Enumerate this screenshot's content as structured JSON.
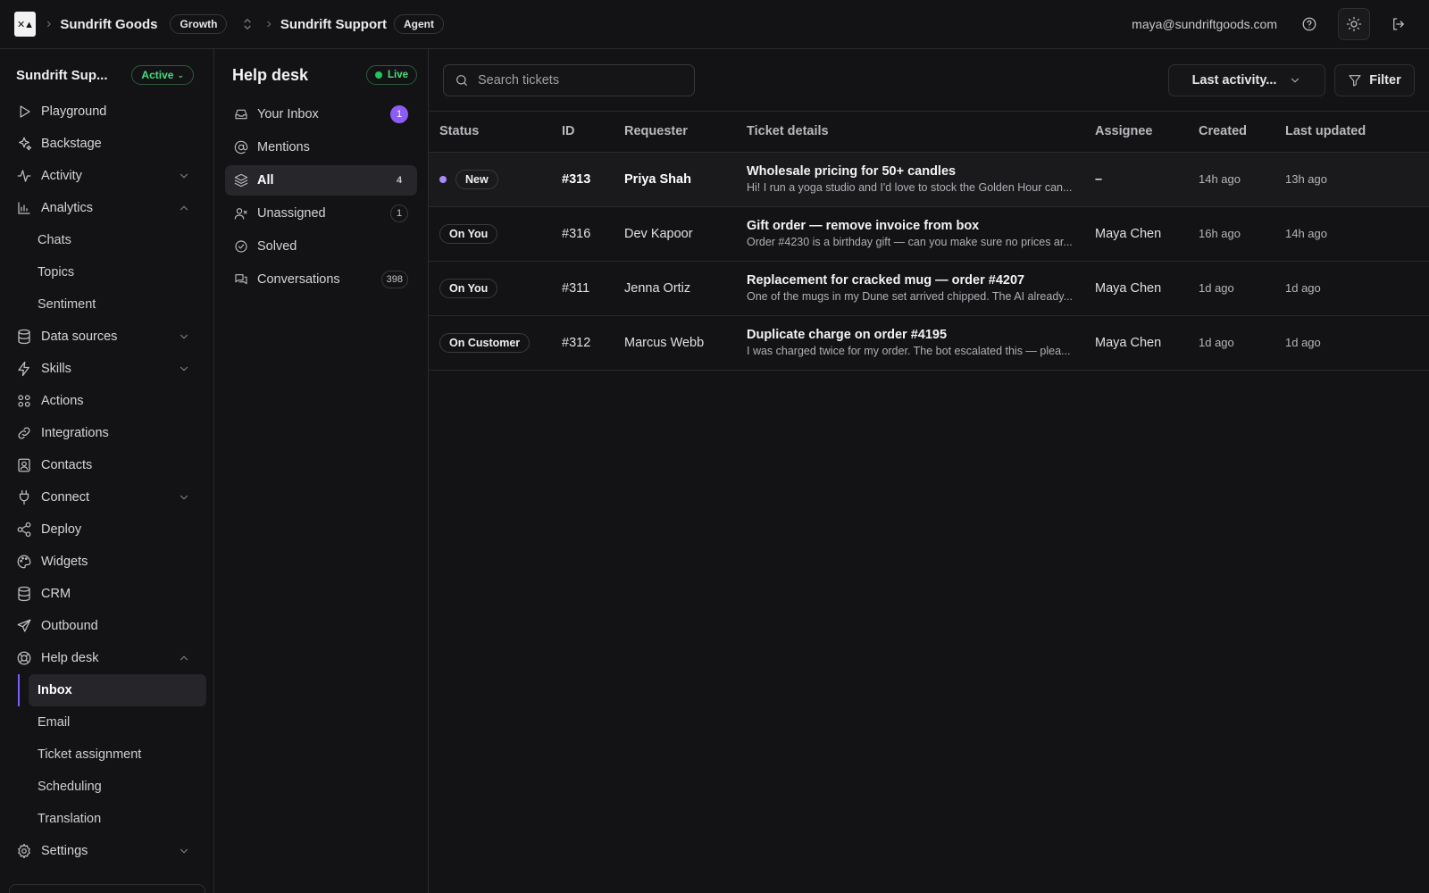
{
  "topbar": {
    "org": "Sundrift Goods",
    "plan": "Growth",
    "project": "Sundrift Support",
    "role": "Agent",
    "email": "maya@sundriftgoods.com"
  },
  "sidebar": {
    "project_name": "Sundrift Sup...",
    "status": "Active",
    "items": [
      {
        "label": "Playground"
      },
      {
        "label": "Backstage"
      },
      {
        "label": "Activity"
      },
      {
        "label": "Analytics"
      },
      {
        "label": "Chats"
      },
      {
        "label": "Topics"
      },
      {
        "label": "Sentiment"
      },
      {
        "label": "Data sources"
      },
      {
        "label": "Skills"
      },
      {
        "label": "Actions"
      },
      {
        "label": "Integrations"
      },
      {
        "label": "Contacts"
      },
      {
        "label": "Connect"
      },
      {
        "label": "Deploy"
      },
      {
        "label": "Widgets"
      },
      {
        "label": "CRM"
      },
      {
        "label": "Outbound"
      },
      {
        "label": "Help desk"
      },
      {
        "label": "Inbox"
      },
      {
        "label": "Email"
      },
      {
        "label": "Ticket assignment"
      },
      {
        "label": "Scheduling"
      },
      {
        "label": "Translation"
      },
      {
        "label": "Settings"
      }
    ]
  },
  "helpdesk": {
    "title": "Help desk",
    "live": "Live",
    "items": [
      {
        "label": "Your Inbox",
        "count": "1"
      },
      {
        "label": "Mentions",
        "count": ""
      },
      {
        "label": "All",
        "count": "4"
      },
      {
        "label": "Unassigned",
        "count": "1"
      },
      {
        "label": "Solved",
        "count": ""
      },
      {
        "label": "Conversations",
        "count": "398"
      }
    ]
  },
  "main": {
    "search_placeholder": "Search tickets",
    "sort_label": "Last activity...",
    "filter_label": "Filter",
    "columns": [
      "Status",
      "ID",
      "Requester",
      "Ticket details",
      "Assignee",
      "Created",
      "Last updated"
    ],
    "rows": [
      {
        "status": "New",
        "id": "#313",
        "requester": "Priya Shah",
        "title": "Wholesale pricing for 50+ candles",
        "preview": "Hi! I run a yoga studio and I'd love to stock the Golden Hour can...",
        "assignee": "–",
        "created": "14h ago",
        "updated": "13h ago"
      },
      {
        "status": "On You",
        "id": "#316",
        "requester": "Dev Kapoor",
        "title": "Gift order — remove invoice from box",
        "preview": "Order #4230 is a birthday gift — can you make sure no prices ar...",
        "assignee": "Maya Chen",
        "created": "16h ago",
        "updated": "14h ago"
      },
      {
        "status": "On You",
        "id": "#311",
        "requester": "Jenna Ortiz",
        "title": "Replacement for cracked mug — order #4207",
        "preview": "One of the mugs in my Dune set arrived chipped. The AI already...",
        "assignee": "Maya Chen",
        "created": "1d ago",
        "updated": "1d ago"
      },
      {
        "status": "On Customer",
        "id": "#312",
        "requester": "Marcus Webb",
        "title": "Duplicate charge on order #4195",
        "preview": "I was charged twice for my order. The bot escalated this — plea...",
        "assignee": "Maya Chen",
        "created": "1d ago",
        "updated": "1d ago"
      }
    ]
  },
  "colors": {
    "accent": "#8b5cf6",
    "live": "#22c55e",
    "background": "#131315"
  }
}
